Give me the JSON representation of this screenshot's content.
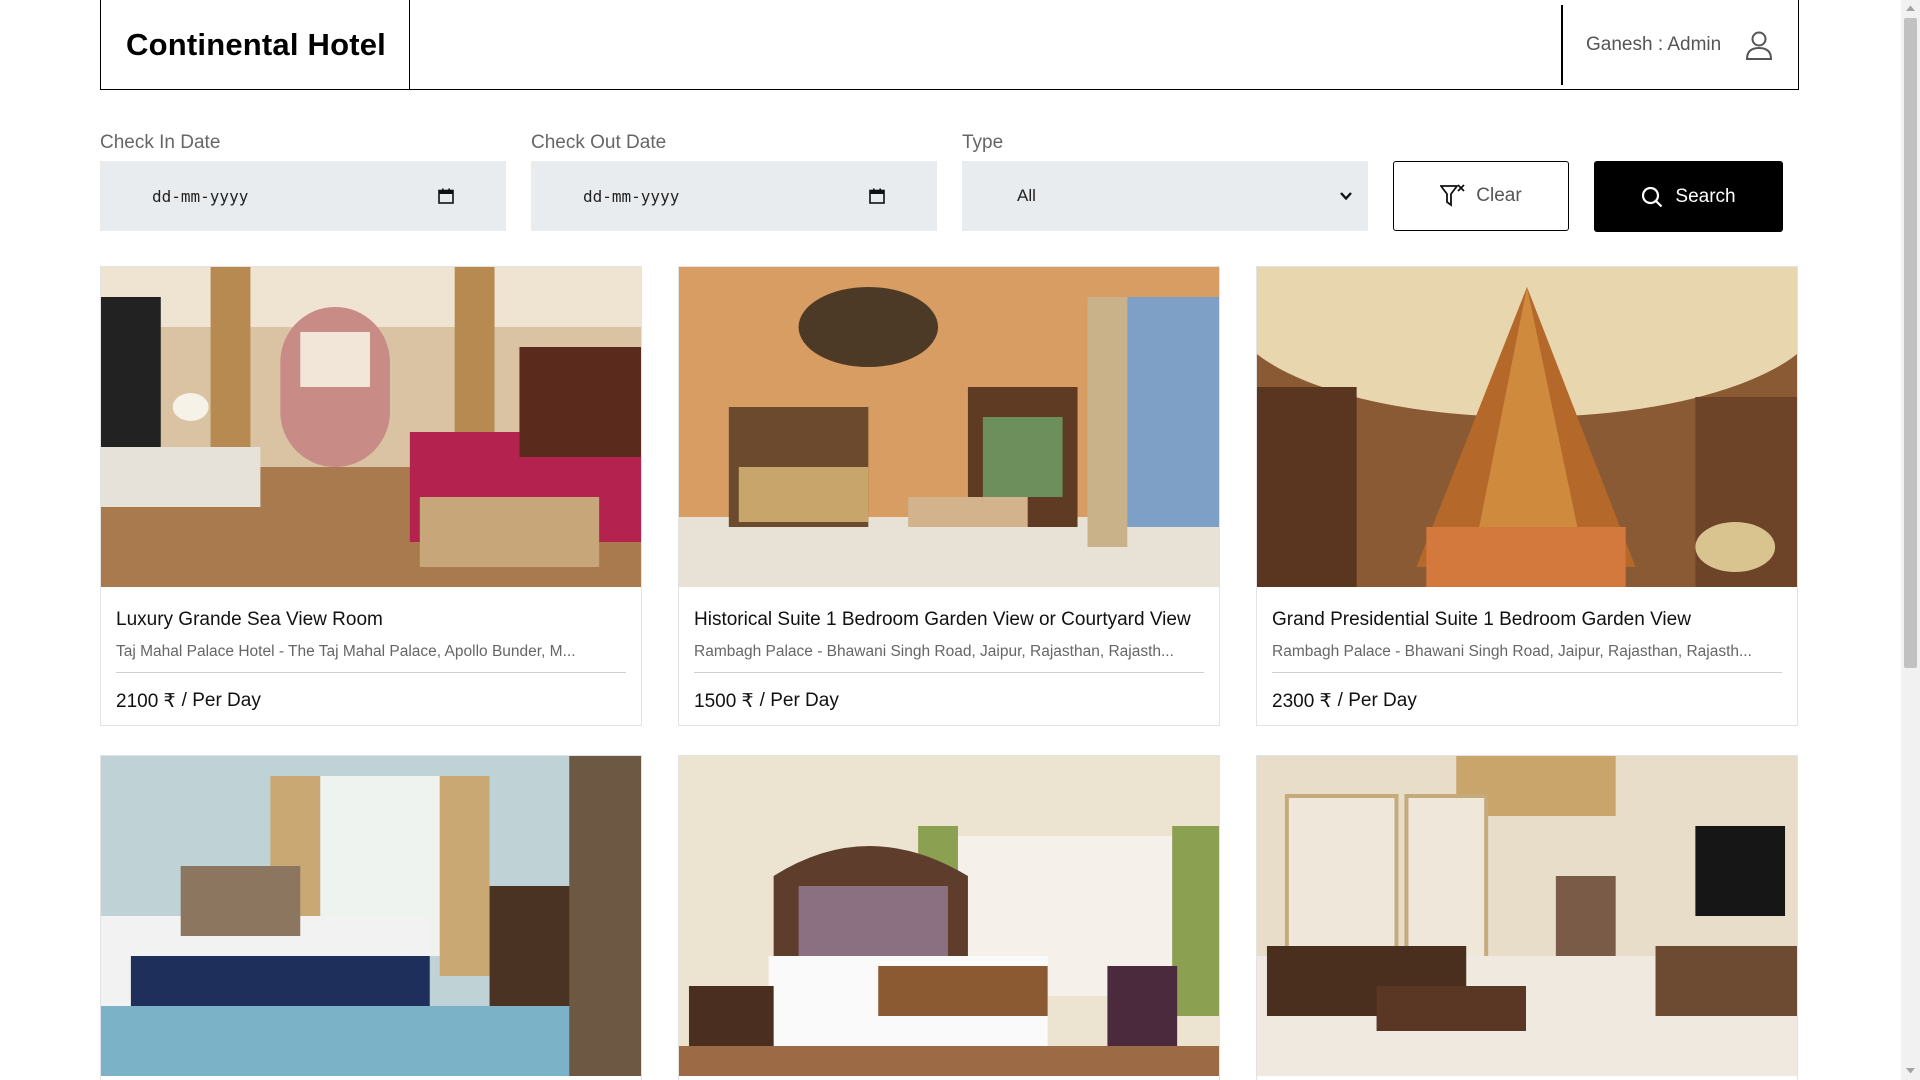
{
  "header": {
    "brand": "Continental Hotel",
    "user_label": "Ganesh : Admin",
    "user_icon": "user-icon"
  },
  "filters": {
    "check_in_label": "Check In Date",
    "check_in_placeholder": "dd-mm-yyyy",
    "check_out_label": "Check Out Date",
    "check_out_placeholder": "dd-mm-yyyy",
    "type_label": "Type",
    "type_value": "All",
    "clear_label": "Clear",
    "search_label": "Search"
  },
  "rooms": [
    {
      "title": "Luxury Grande Sea View Room",
      "address": "Taj Mahal Palace Hotel - The Taj Mahal Palace, Apollo Bunder, M...",
      "price": "2100 ₹",
      "unit": "/ Per Day"
    },
    {
      "title": "Historical Suite 1 Bedroom Garden View or Courtyard View",
      "address": "Rambagh Palace - Bhawani Singh Road, Jaipur, Rajasthan, Rajasth...",
      "price": "1500 ₹",
      "unit": "/ Per Day"
    },
    {
      "title": "Grand Presidential Suite 1 Bedroom Garden View",
      "address": "Rambagh Palace - Bhawani Singh Road, Jaipur, Rajasthan, Rajasth...",
      "price": "2300 ₹",
      "unit": "/ Per Day"
    },
    {
      "title": "",
      "address": "",
      "price": "",
      "unit": ""
    },
    {
      "title": "",
      "address": "",
      "price": "",
      "unit": ""
    },
    {
      "title": "",
      "address": "",
      "price": "",
      "unit": ""
    }
  ],
  "colors": {
    "accent": "#000000",
    "field_bg": "#e9ecef",
    "muted_text": "#666666"
  }
}
